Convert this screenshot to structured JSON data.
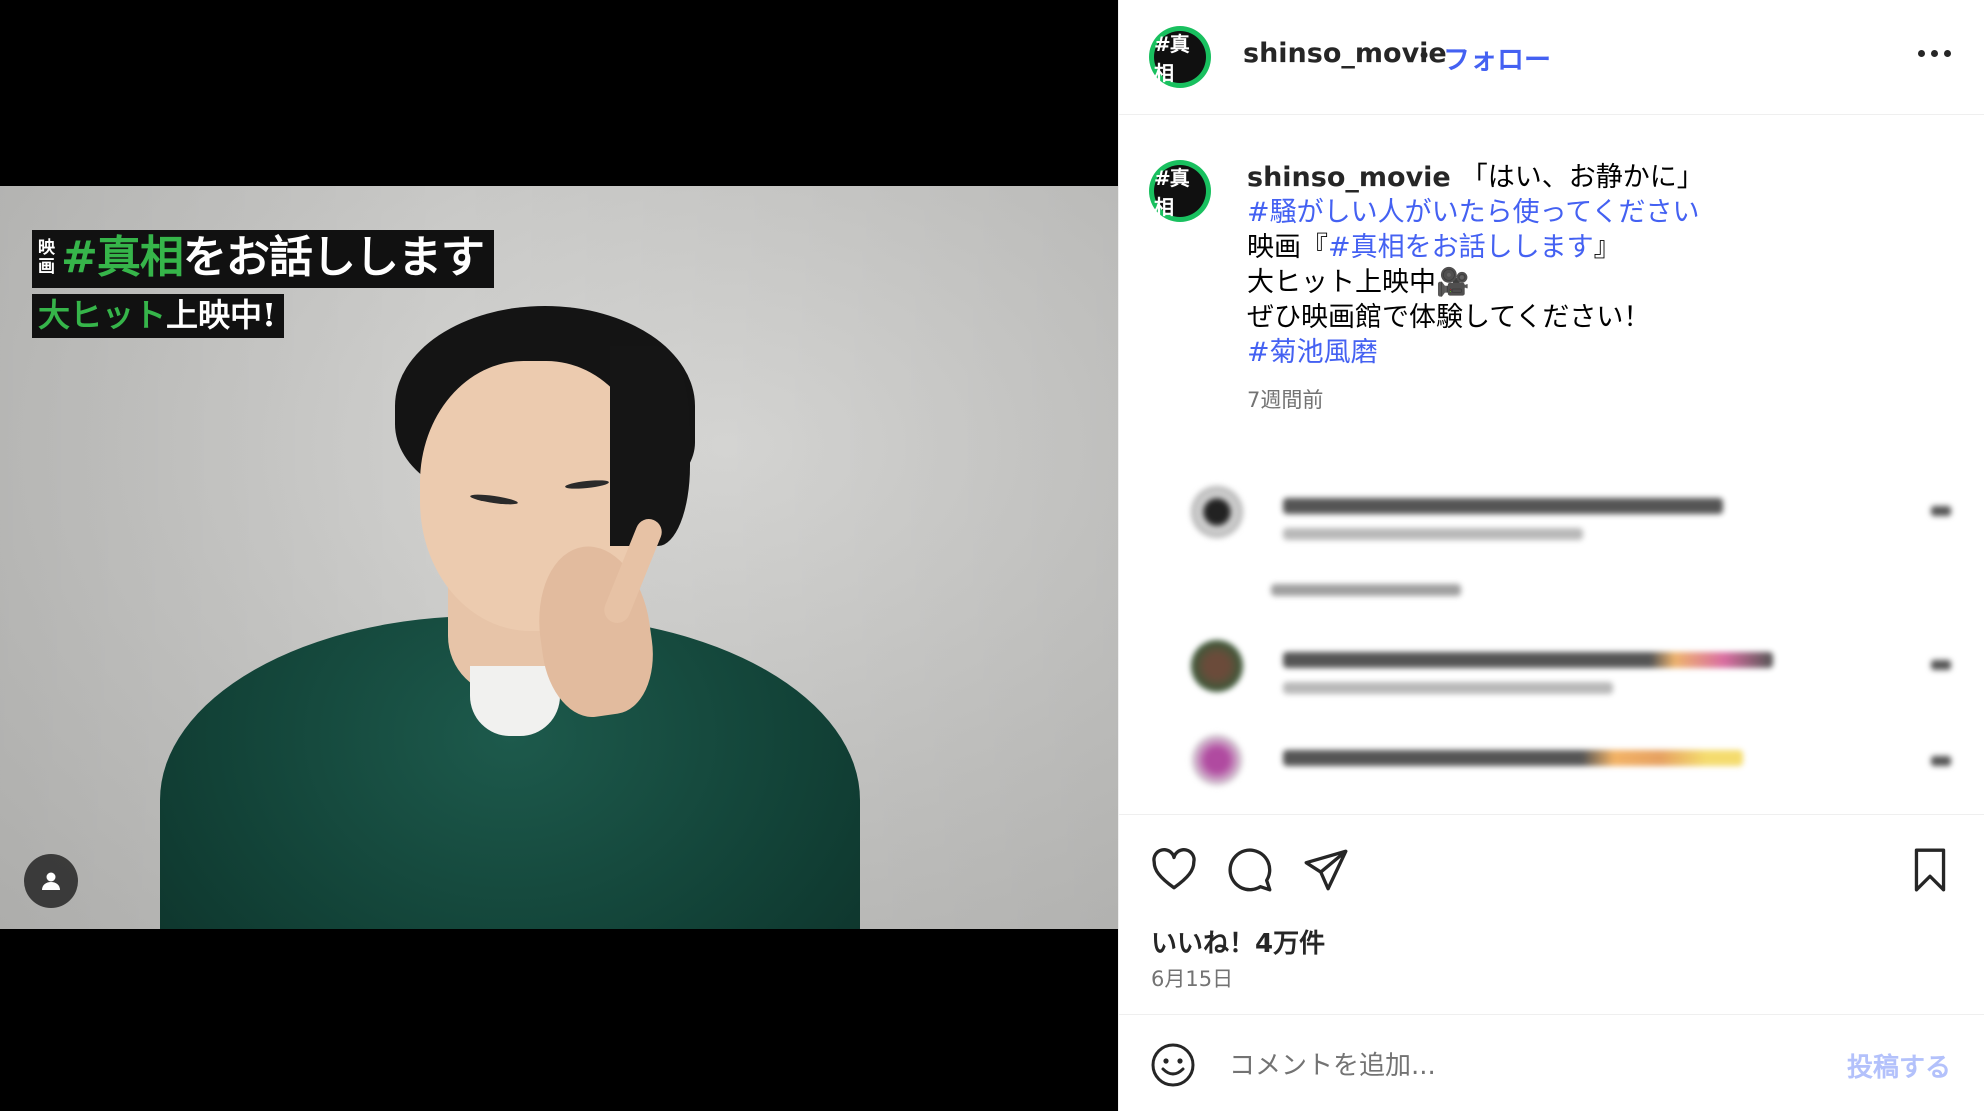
{
  "media": {
    "overlay": {
      "eiga_top": "映",
      "eiga_bottom": "画",
      "title_hash": "#真相",
      "title_rest": "をお話しします",
      "sub_green": "大ヒット",
      "sub_white": "上映中!"
    },
    "user_tag_icon": "person-icon"
  },
  "header": {
    "avatar_text": "#真相",
    "username": "shinso_movie",
    "separator": "•",
    "follow_label": "フォロー",
    "more_icon": "more-horizontal-icon"
  },
  "caption": {
    "avatar_text": "#真相",
    "username": "shinso_movie",
    "line1": "「はい、お静かに」",
    "hashtag1": "#騒がしい人がいたら使ってください",
    "line3_prefix": "映画『",
    "hashtag2": "#真相をお話しします",
    "line3_suffix": "』",
    "line4": "大ヒット上映中",
    "line4_emoji": "🎥",
    "line5": "ぜひ映画館で体験してください！",
    "hashtag3": "#菊池風磨",
    "time_ago": "7週間前"
  },
  "actions": {
    "like_icon": "heart-icon",
    "comment_icon": "comment-icon",
    "share_icon": "paper-plane-icon",
    "save_icon": "bookmark-icon",
    "likes_text": "いいね！4万件",
    "date_text": "6月15日"
  },
  "add_comment": {
    "placeholder": "コメントを追加...",
    "post_label": "投稿する",
    "emoji_icon": "smiley-icon"
  },
  "colors": {
    "link_blue": "#4461f2",
    "post_disabled": "#b3c1fb",
    "avatar_ring": "#19c05f",
    "overlay_green": "#36b54a"
  }
}
